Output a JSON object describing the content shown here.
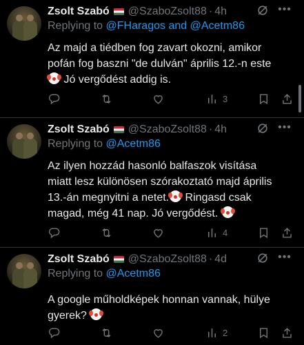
{
  "tweets": [
    {
      "name": "Zsolt Szabó",
      "handle": "@SzaboZsolt88",
      "time": "4h",
      "reply_prefix": "Replying to",
      "reply_to": "@FHaragos and @Acetm86",
      "text_lines": [
        "Az majd a tiédben fog zavart okozni, amikor",
        "pofán fog baszni \"de dulván\" április 12.-n este",
        " Jó vergődést addig is."
      ],
      "views": "3"
    },
    {
      "name": "Zsolt Szabó",
      "handle": "@SzaboZsolt88",
      "time": "4h",
      "reply_prefix": "Replying to",
      "reply_to": "@Acetm86",
      "text_lines": [
        "Az ilyen hozzád hasonló balfaszok visítása",
        "miatt lesz különösen szórakoztató majd április",
        "13.-án megnyitni a netet.",
        " Ringasd csak",
        "magad, még 41 nap. Jó vergődést."
      ],
      "views": "4"
    },
    {
      "name": "Zsolt Szabó",
      "handle": "@SzaboZsolt88",
      "time": "4d",
      "reply_prefix": "Replying to",
      "reply_to": "@Acetm86",
      "text_lines": [
        "A google műholdképek honnan vannak, hülye",
        "gyerek?"
      ],
      "views": "2"
    }
  ],
  "colors": {
    "link": "#1d9bf0",
    "muted": "#71767b",
    "text": "#e7e9ea",
    "background": "#000000"
  },
  "icons": [
    "reply-icon",
    "retweet-icon",
    "like-icon",
    "views-icon",
    "bookmark-icon",
    "share-icon",
    "grok-icon",
    "more-icon",
    "flag-hu-icon",
    "clown-emoji"
  ]
}
